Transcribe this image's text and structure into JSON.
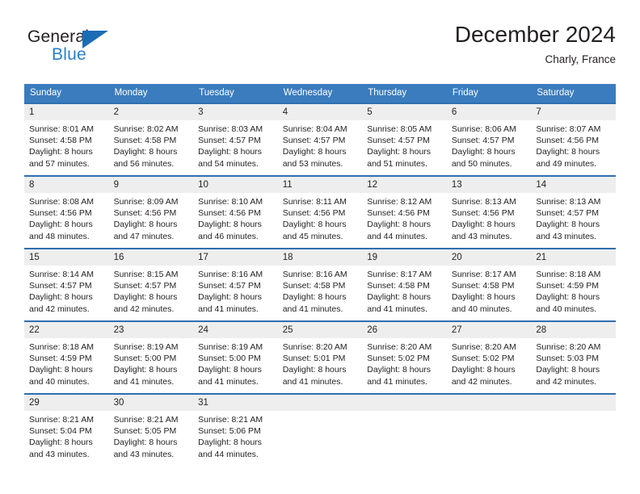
{
  "brand": {
    "name_top": "General",
    "name_bottom": "Blue",
    "triangle_color": "#1c6cb4",
    "blue_text_color": "#2b7fc4"
  },
  "header": {
    "title": "December 2024",
    "location": "Charly, France"
  },
  "theme": {
    "header_row_bg": "#3a7cbe",
    "cell_rule_color": "#2f6fb0",
    "daynum_bg": "#eeeeee",
    "text_color": "#231f20"
  },
  "calendar": {
    "weekday_headers": [
      "Sunday",
      "Monday",
      "Tuesday",
      "Wednesday",
      "Thursday",
      "Friday",
      "Saturday"
    ],
    "weeks": [
      [
        {
          "day": "1",
          "sunrise": "Sunrise: 8:01 AM",
          "sunset": "Sunset: 4:58 PM",
          "daylight_line1": "Daylight: 8 hours",
          "daylight_line2": "and 57 minutes."
        },
        {
          "day": "2",
          "sunrise": "Sunrise: 8:02 AM",
          "sunset": "Sunset: 4:58 PM",
          "daylight_line1": "Daylight: 8 hours",
          "daylight_line2": "and 56 minutes."
        },
        {
          "day": "3",
          "sunrise": "Sunrise: 8:03 AM",
          "sunset": "Sunset: 4:57 PM",
          "daylight_line1": "Daylight: 8 hours",
          "daylight_line2": "and 54 minutes."
        },
        {
          "day": "4",
          "sunrise": "Sunrise: 8:04 AM",
          "sunset": "Sunset: 4:57 PM",
          "daylight_line1": "Daylight: 8 hours",
          "daylight_line2": "and 53 minutes."
        },
        {
          "day": "5",
          "sunrise": "Sunrise: 8:05 AM",
          "sunset": "Sunset: 4:57 PM",
          "daylight_line1": "Daylight: 8 hours",
          "daylight_line2": "and 51 minutes."
        },
        {
          "day": "6",
          "sunrise": "Sunrise: 8:06 AM",
          "sunset": "Sunset: 4:57 PM",
          "daylight_line1": "Daylight: 8 hours",
          "daylight_line2": "and 50 minutes."
        },
        {
          "day": "7",
          "sunrise": "Sunrise: 8:07 AM",
          "sunset": "Sunset: 4:56 PM",
          "daylight_line1": "Daylight: 8 hours",
          "daylight_line2": "and 49 minutes."
        }
      ],
      [
        {
          "day": "8",
          "sunrise": "Sunrise: 8:08 AM",
          "sunset": "Sunset: 4:56 PM",
          "daylight_line1": "Daylight: 8 hours",
          "daylight_line2": "and 48 minutes."
        },
        {
          "day": "9",
          "sunrise": "Sunrise: 8:09 AM",
          "sunset": "Sunset: 4:56 PM",
          "daylight_line1": "Daylight: 8 hours",
          "daylight_line2": "and 47 minutes."
        },
        {
          "day": "10",
          "sunrise": "Sunrise: 8:10 AM",
          "sunset": "Sunset: 4:56 PM",
          "daylight_line1": "Daylight: 8 hours",
          "daylight_line2": "and 46 minutes."
        },
        {
          "day": "11",
          "sunrise": "Sunrise: 8:11 AM",
          "sunset": "Sunset: 4:56 PM",
          "daylight_line1": "Daylight: 8 hours",
          "daylight_line2": "and 45 minutes."
        },
        {
          "day": "12",
          "sunrise": "Sunrise: 8:12 AM",
          "sunset": "Sunset: 4:56 PM",
          "daylight_line1": "Daylight: 8 hours",
          "daylight_line2": "and 44 minutes."
        },
        {
          "day": "13",
          "sunrise": "Sunrise: 8:13 AM",
          "sunset": "Sunset: 4:56 PM",
          "daylight_line1": "Daylight: 8 hours",
          "daylight_line2": "and 43 minutes."
        },
        {
          "day": "14",
          "sunrise": "Sunrise: 8:13 AM",
          "sunset": "Sunset: 4:57 PM",
          "daylight_line1": "Daylight: 8 hours",
          "daylight_line2": "and 43 minutes."
        }
      ],
      [
        {
          "day": "15",
          "sunrise": "Sunrise: 8:14 AM",
          "sunset": "Sunset: 4:57 PM",
          "daylight_line1": "Daylight: 8 hours",
          "daylight_line2": "and 42 minutes."
        },
        {
          "day": "16",
          "sunrise": "Sunrise: 8:15 AM",
          "sunset": "Sunset: 4:57 PM",
          "daylight_line1": "Daylight: 8 hours",
          "daylight_line2": "and 42 minutes."
        },
        {
          "day": "17",
          "sunrise": "Sunrise: 8:16 AM",
          "sunset": "Sunset: 4:57 PM",
          "daylight_line1": "Daylight: 8 hours",
          "daylight_line2": "and 41 minutes."
        },
        {
          "day": "18",
          "sunrise": "Sunrise: 8:16 AM",
          "sunset": "Sunset: 4:58 PM",
          "daylight_line1": "Daylight: 8 hours",
          "daylight_line2": "and 41 minutes."
        },
        {
          "day": "19",
          "sunrise": "Sunrise: 8:17 AM",
          "sunset": "Sunset: 4:58 PM",
          "daylight_line1": "Daylight: 8 hours",
          "daylight_line2": "and 41 minutes."
        },
        {
          "day": "20",
          "sunrise": "Sunrise: 8:17 AM",
          "sunset": "Sunset: 4:58 PM",
          "daylight_line1": "Daylight: 8 hours",
          "daylight_line2": "and 40 minutes."
        },
        {
          "day": "21",
          "sunrise": "Sunrise: 8:18 AM",
          "sunset": "Sunset: 4:59 PM",
          "daylight_line1": "Daylight: 8 hours",
          "daylight_line2": "and 40 minutes."
        }
      ],
      [
        {
          "day": "22",
          "sunrise": "Sunrise: 8:18 AM",
          "sunset": "Sunset: 4:59 PM",
          "daylight_line1": "Daylight: 8 hours",
          "daylight_line2": "and 40 minutes."
        },
        {
          "day": "23",
          "sunrise": "Sunrise: 8:19 AM",
          "sunset": "Sunset: 5:00 PM",
          "daylight_line1": "Daylight: 8 hours",
          "daylight_line2": "and 41 minutes."
        },
        {
          "day": "24",
          "sunrise": "Sunrise: 8:19 AM",
          "sunset": "Sunset: 5:00 PM",
          "daylight_line1": "Daylight: 8 hours",
          "daylight_line2": "and 41 minutes."
        },
        {
          "day": "25",
          "sunrise": "Sunrise: 8:20 AM",
          "sunset": "Sunset: 5:01 PM",
          "daylight_line1": "Daylight: 8 hours",
          "daylight_line2": "and 41 minutes."
        },
        {
          "day": "26",
          "sunrise": "Sunrise: 8:20 AM",
          "sunset": "Sunset: 5:02 PM",
          "daylight_line1": "Daylight: 8 hours",
          "daylight_line2": "and 41 minutes."
        },
        {
          "day": "27",
          "sunrise": "Sunrise: 8:20 AM",
          "sunset": "Sunset: 5:02 PM",
          "daylight_line1": "Daylight: 8 hours",
          "daylight_line2": "and 42 minutes."
        },
        {
          "day": "28",
          "sunrise": "Sunrise: 8:20 AM",
          "sunset": "Sunset: 5:03 PM",
          "daylight_line1": "Daylight: 8 hours",
          "daylight_line2": "and 42 minutes."
        }
      ],
      [
        {
          "day": "29",
          "sunrise": "Sunrise: 8:21 AM",
          "sunset": "Sunset: 5:04 PM",
          "daylight_line1": "Daylight: 8 hours",
          "daylight_line2": "and 43 minutes."
        },
        {
          "day": "30",
          "sunrise": "Sunrise: 8:21 AM",
          "sunset": "Sunset: 5:05 PM",
          "daylight_line1": "Daylight: 8 hours",
          "daylight_line2": "and 43 minutes."
        },
        {
          "day": "31",
          "sunrise": "Sunrise: 8:21 AM",
          "sunset": "Sunset: 5:06 PM",
          "daylight_line1": "Daylight: 8 hours",
          "daylight_line2": "and 44 minutes."
        },
        {
          "day": "",
          "sunrise": "",
          "sunset": "",
          "daylight_line1": "",
          "daylight_line2": ""
        },
        {
          "day": "",
          "sunrise": "",
          "sunset": "",
          "daylight_line1": "",
          "daylight_line2": ""
        },
        {
          "day": "",
          "sunrise": "",
          "sunset": "",
          "daylight_line1": "",
          "daylight_line2": ""
        },
        {
          "day": "",
          "sunrise": "",
          "sunset": "",
          "daylight_line1": "",
          "daylight_line2": ""
        }
      ]
    ]
  }
}
